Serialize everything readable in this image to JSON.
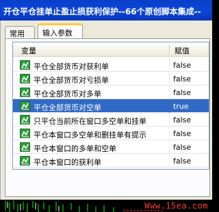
{
  "title": "开仓平仓挂单止盈止损获利保护--66个原创脚本集成--",
  "tabs": [
    {
      "label": "常用"
    },
    {
      "label": "输入参数"
    }
  ],
  "table": {
    "headers": {
      "variable": "变量",
      "value": "赋值"
    },
    "rows": [
      {
        "name": "平仓全部货币对获利单",
        "value": "false",
        "icon": "parameter-icon"
      },
      {
        "name": "平仓全部货币对亏损单",
        "value": "false",
        "icon": "parameter-icon"
      },
      {
        "name": "平仓全部货币对多单",
        "value": "false",
        "icon": "parameter-icon"
      },
      {
        "name": "平仓全部货币对空单",
        "value": "true",
        "icon": "parameter-icon",
        "selected": true
      },
      {
        "name": "只平仓当前所在窗口多空单和挂单",
        "value": "false",
        "icon": "parameter-icon"
      },
      {
        "name": "平仓本窗口多空单和删挂单有提示",
        "value": "false",
        "icon": "parameter-icon"
      },
      {
        "name": "平仓本窗口的多单和空单",
        "value": "false",
        "icon": "parameter-icon"
      },
      {
        "name": "平仓本窗口的获利单",
        "value": "false",
        "icon": "parameter-icon"
      }
    ]
  },
  "watermark": "Www.15ea.com",
  "colors": {
    "titlebar": "#0b46d8",
    "selection": "#316ac5",
    "active_tab_accent": "#ffc83c",
    "watermark": "#ff3c3c",
    "icon": "#2e9d3b"
  }
}
